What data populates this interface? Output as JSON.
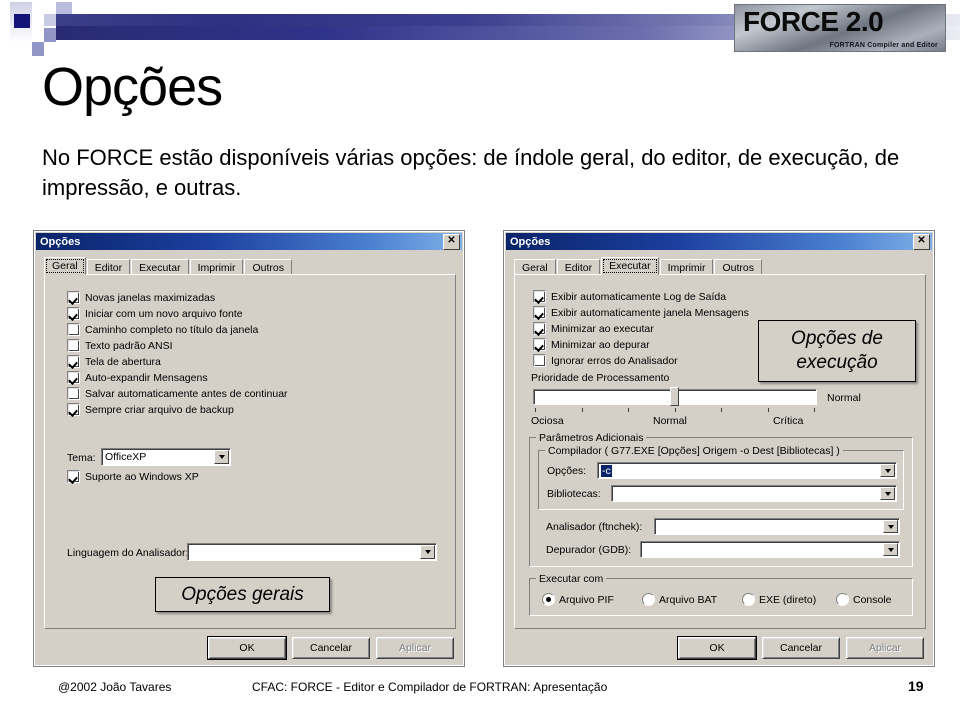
{
  "header": {
    "logo_text": "FORCE 2.0",
    "logo_subtitle": "FORTRAN Compiler and Editor"
  },
  "slide": {
    "title": "Opções",
    "subtitle": "No FORCE estão disponíveis várias opções: de índole geral, do editor, de execução, de impressão, e outras."
  },
  "dialog_left": {
    "titlebar": "Opções",
    "close_glyph": "✕",
    "tabs": [
      {
        "label": "Geral",
        "active": true
      },
      {
        "label": "Editor",
        "active": false
      },
      {
        "label": "Executar",
        "active": false
      },
      {
        "label": "Imprimir",
        "active": false
      },
      {
        "label": "Outros",
        "active": false
      }
    ],
    "checkboxes": [
      {
        "label": "Novas janelas maximizadas",
        "checked": true
      },
      {
        "label": "Iniciar com um novo arquivo fonte",
        "checked": true
      },
      {
        "label": "Caminho completo no título da janela",
        "checked": false
      },
      {
        "label": "Texto padrão ANSI",
        "checked": false
      },
      {
        "label": "Tela de abertura",
        "checked": true
      },
      {
        "label": "Auto-expandir Mensagens",
        "checked": true
      },
      {
        "label": "Salvar automaticamente antes de continuar",
        "checked": false
      },
      {
        "label": "Sempre criar arquivo de backup",
        "checked": true
      }
    ],
    "theme_label": "Tema:",
    "theme_value": "OfficeXP",
    "winxp_support_label": "Suporte ao Windows XP",
    "winxp_support_checked": true,
    "analyzer_language_label": "Linguagem do Analisador:",
    "analyzer_language_value": "",
    "buttons": {
      "ok": "OK",
      "cancel": "Cancelar",
      "apply": "Aplicar"
    },
    "callout": "Opções gerais"
  },
  "dialog_right": {
    "titlebar": "Opções",
    "close_glyph": "✕",
    "tabs": [
      {
        "label": "Geral",
        "active": false
      },
      {
        "label": "Editor",
        "active": false
      },
      {
        "label": "Executar",
        "active": true
      },
      {
        "label": "Imprimir",
        "active": false
      },
      {
        "label": "Outros",
        "active": false
      }
    ],
    "checkboxes": [
      {
        "label": "Exibir automaticamente Log de Saída",
        "checked": true
      },
      {
        "label": "Exibir automaticamente janela Mensagens",
        "checked": true
      },
      {
        "label": "Minimizar ao executar",
        "checked": true
      },
      {
        "label": "Minimizar ao depurar",
        "checked": true
      },
      {
        "label": "Ignorar erros do Analisador",
        "checked": false
      }
    ],
    "priority_label": "Prioridade de Processamento",
    "priority_value": "Normal",
    "priority_scale": {
      "low": "Ociosa",
      "mid": "Normal",
      "high": "Crítica"
    },
    "additional_params_title": "Parâmetros Adicionais",
    "compiler_group_title": "Compilador ( G77.EXE [Opções] Origem -o Dest [Bibliotecas] )",
    "compiler_options_label": "Opções:",
    "compiler_options_value": "-c",
    "libraries_label": "Bibliotecas:",
    "libraries_value": "",
    "analyzer_label": "Analisador (ftnchek):",
    "analyzer_value": "",
    "debugger_label": "Depurador (GDB):",
    "debugger_value": "",
    "run_with_title": "Executar com",
    "run_with_options": [
      {
        "label": "Arquivo PIF",
        "selected": true
      },
      {
        "label": "Arquivo BAT",
        "selected": false
      },
      {
        "label": "EXE (direto)",
        "selected": false
      },
      {
        "label": "Console",
        "selected": false
      }
    ],
    "buttons": {
      "ok": "OK",
      "cancel": "Cancelar",
      "apply": "Aplicar"
    },
    "callout": "Opções de execução"
  },
  "footer": {
    "copyright": "@2002 João Tavares",
    "center": "CFAC: FORCE - Editor e Compilador de FORTRAN: Apresentação",
    "page_number": "19"
  }
}
